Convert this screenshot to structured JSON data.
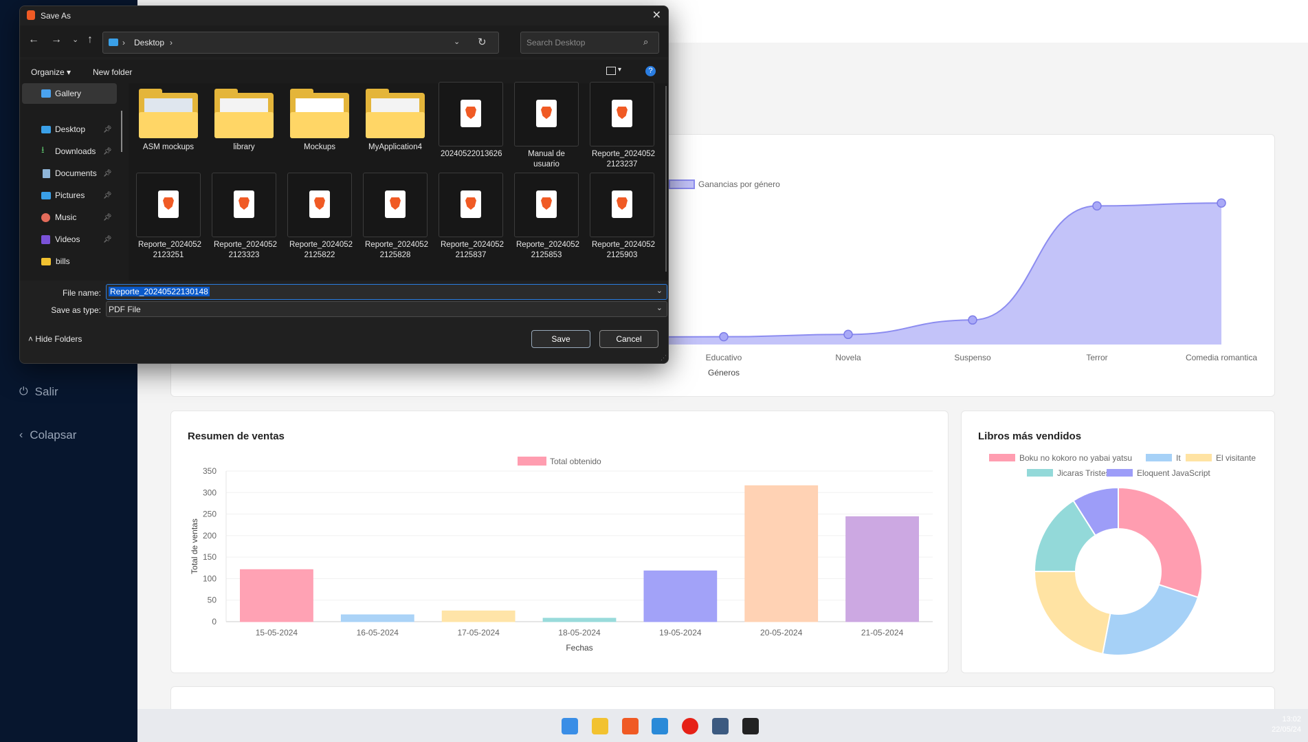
{
  "sidebar": {
    "items": [
      {
        "label": "Salir",
        "icon": "power-icon"
      },
      {
        "label": "Colapsar",
        "icon": "chevron-left-icon"
      }
    ]
  },
  "genre_chart": {
    "legend": "Ganancias por género",
    "xlabel": "Géneros"
  },
  "sales_card": {
    "title": "Resumen de ventas"
  },
  "top_card": {
    "title": "Libros más vendidos"
  },
  "chart_data": [
    {
      "type": "area",
      "title": "",
      "xlabel": "Géneros",
      "ylabel": "",
      "categories": [
        "Educativo",
        "Novela",
        "Suspenso",
        "Terror",
        "Comedia romantica"
      ],
      "series": [
        {
          "name": "Ganancias por género",
          "values": [
            27,
            35,
            85,
            480,
            490
          ],
          "color": "#9b9bf5"
        }
      ],
      "legend_position": "top"
    },
    {
      "type": "bar",
      "title": "",
      "xlabel": "Fechas",
      "ylabel": "Total de ventas",
      "ylim": [
        0,
        350
      ],
      "yticks": [
        0,
        50,
        100,
        150,
        200,
        250,
        300,
        350
      ],
      "categories": [
        "15-05-2024",
        "16-05-2024",
        "17-05-2024",
        "18-05-2024",
        "19-05-2024",
        "20-05-2024",
        "21-05-2024"
      ],
      "series": [
        {
          "name": "Total obtenido",
          "values": [
            121,
            16,
            25,
            8,
            118,
            316,
            244
          ]
        }
      ],
      "colors": [
        "#ff9db0",
        "#a6d1f7",
        "#ffe3a3",
        "#93d9d9",
        "#9d9df8",
        "#ffd0b0",
        "#c9a3e0"
      ],
      "legend_position": "top"
    },
    {
      "type": "pie",
      "title": "",
      "labels": [
        "Boku no kokoro no yabai yatsu",
        "It",
        "El visitante",
        "Jicaras Tristes",
        "Eloquent JavaScript"
      ],
      "values": [
        30,
        23,
        22,
        16,
        9
      ],
      "colors": [
        "#ff9db0",
        "#a6d1f7",
        "#ffe3a3",
        "#93d9d9",
        "#9d9df8"
      ],
      "legend_position": "top"
    }
  ],
  "dialog": {
    "title": "Save As",
    "breadcrumb": "Desktop",
    "search_placeholder": "Search Desktop",
    "organize": "Organize",
    "new_folder": "New folder",
    "nav": [
      {
        "label": "Gallery",
        "pinned": false
      },
      {
        "label": "Desktop",
        "pinned": true
      },
      {
        "label": "Downloads",
        "pinned": true
      },
      {
        "label": "Documents",
        "pinned": true
      },
      {
        "label": "Pictures",
        "pinned": true
      },
      {
        "label": "Music",
        "pinned": true
      },
      {
        "label": "Videos",
        "pinned": true
      },
      {
        "label": "bills",
        "pinned": false
      }
    ],
    "files_row1": [
      {
        "name": "ASM mockups",
        "kind": "folder"
      },
      {
        "name": "library",
        "kind": "folder"
      },
      {
        "name": "Mockups",
        "kind": "folder"
      },
      {
        "name": "MyApplication4",
        "kind": "folder"
      },
      {
        "name": "20240522013626",
        "kind": "pdf"
      },
      {
        "name": "Manual de usuario",
        "kind": "pdf"
      },
      {
        "name": "Reporte_2024052 2123237",
        "kind": "pdf"
      }
    ],
    "files_row2": [
      {
        "name": "Reporte_2024052 2123251",
        "kind": "pdf"
      },
      {
        "name": "Reporte_2024052 2123323",
        "kind": "pdf"
      },
      {
        "name": "Reporte_2024052 2125822",
        "kind": "pdf"
      },
      {
        "name": "Reporte_2024052 2125828",
        "kind": "pdf"
      },
      {
        "name": "Reporte_2024052 2125837",
        "kind": "pdf"
      },
      {
        "name": "Reporte_2024052 2125853",
        "kind": "pdf"
      },
      {
        "name": "Reporte_2024052 2125903",
        "kind": "pdf"
      }
    ],
    "file_name_label": "File name:",
    "file_name_value": "Reporte_20240522130148",
    "save_type_label": "Save as type:",
    "save_type_value": "PDF File",
    "hide_folders": "Hide Folders",
    "save": "Save",
    "cancel": "Cancel"
  },
  "taskbar": {
    "time": "13:02",
    "date": "22/05/24",
    "icons": [
      "windows-start-icon",
      "file-explorer-icon",
      "brave-browser-icon",
      "vscode-icon",
      "youtube-music-icon",
      "sql-server-icon",
      "figma-icon"
    ]
  }
}
